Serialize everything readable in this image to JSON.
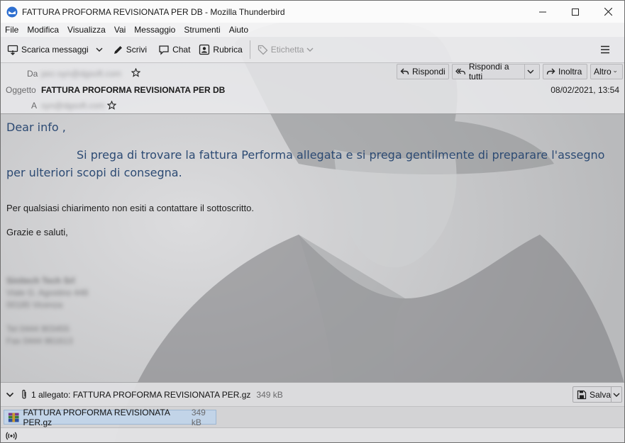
{
  "window": {
    "title": "FATTURA PROFORMA REVISIONATA PER DB - Mozilla Thunderbird",
    "minimize_icon": "minimize-icon",
    "maximize_icon": "maximize-icon",
    "close_icon": "close-icon"
  },
  "menu": [
    "File",
    "Modifica",
    "Visualizza",
    "Vai",
    "Messaggio",
    "Strumenti",
    "Aiuto"
  ],
  "toolbar": {
    "get_messages": "Scarica messaggi",
    "write": "Scrivi",
    "chat": "Chat",
    "address_book": "Rubrica",
    "tag": "Etichetta",
    "menu_icon": "hamburger-icon"
  },
  "header": {
    "from_label": "Da",
    "from_value": "pec-syn@dgsoft.com",
    "subject_label": "Oggetto",
    "subject": "FATTURA PROFORMA REVISIONATA PER DB",
    "to_label": "A",
    "to_value": "syn@dgsoft.com",
    "date": "08/02/2021, 13:54",
    "reply": "Rispondi",
    "reply_all": "Rispondi a tutti",
    "forward": "Inoltra",
    "more": "Altro"
  },
  "message": {
    "greeting": "Dear info ,",
    "paragraph1": "Si prega di trovare la fattura Performa allegata e si prega gentilmente di preparare l'assegno per ulteriori scopi di consegna.",
    "paragraph2": "Per qualsiasi chiarimento non esiti a contattare il sottoscritto.",
    "closing": "Grazie e saluti,",
    "signature": [
      "Sinitech Tech Srl",
      "Viale G. Agostino 448",
      "00185 Vicenza",
      "Tel 0444 903455",
      "Fax 0444 961613"
    ]
  },
  "attachments": {
    "summary": "1 allegato: FATTURA PROFORMA REVISIONATA PER.gz",
    "summary_size": "349 kB",
    "save": "Salva",
    "items": [
      {
        "name": "FATTURA PROFORMA REVISIONATA PER.gz",
        "size": "349 kB"
      }
    ]
  },
  "status": {
    "icon": "online-status-icon"
  },
  "colors": {
    "body_text": "#2c4a73",
    "selection": "#c2d4e8"
  }
}
